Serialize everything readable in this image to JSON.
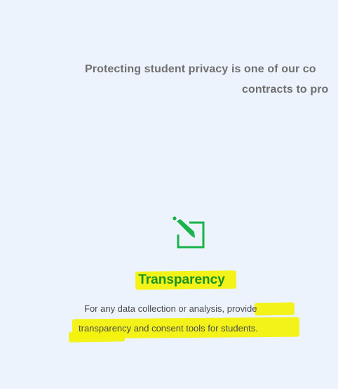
{
  "intro": {
    "line1": "Protecting student privacy is one of our co",
    "line2": "contracts to pro"
  },
  "feature": {
    "icon": "pencil-square-icon",
    "accent_color": "#18b34a",
    "title": "Transparency",
    "description_part1": "For any data collection or analysis, ",
    "description_part2": "provide",
    "description_line2": "transparency and consent tools for students."
  },
  "highlight_color": "#f3f20e"
}
